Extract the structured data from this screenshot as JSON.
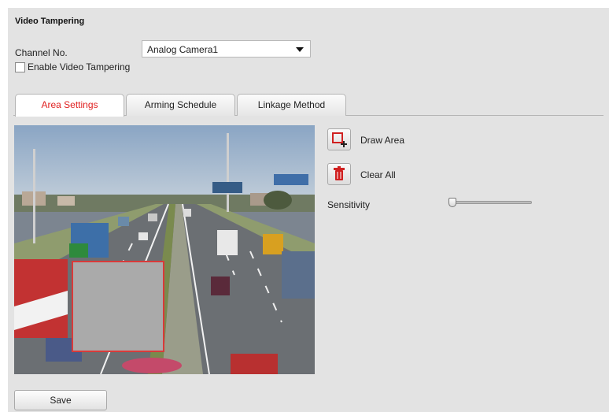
{
  "section_title": "Video Tampering",
  "channel": {
    "label": "Channel No.",
    "selected": "Analog Camera1"
  },
  "enable_tampering": {
    "label": "Enable Video Tampering",
    "checked": false
  },
  "tabs": [
    {
      "label": "Area Settings",
      "active": true
    },
    {
      "label": "Arming Schedule",
      "active": false
    },
    {
      "label": "Linkage Method",
      "active": false
    }
  ],
  "tools": {
    "draw_area": {
      "label": "Draw Area",
      "icon": "draw-area-icon"
    },
    "clear_all": {
      "label": "Clear All",
      "icon": "trash-icon"
    }
  },
  "sensitivity": {
    "label": "Sensitivity",
    "value": 0
  },
  "save_label": "Save",
  "colors": {
    "accent_red": "#e02020",
    "panel_bg": "#e3e3e3",
    "area_fill": "#aaaaaa"
  }
}
